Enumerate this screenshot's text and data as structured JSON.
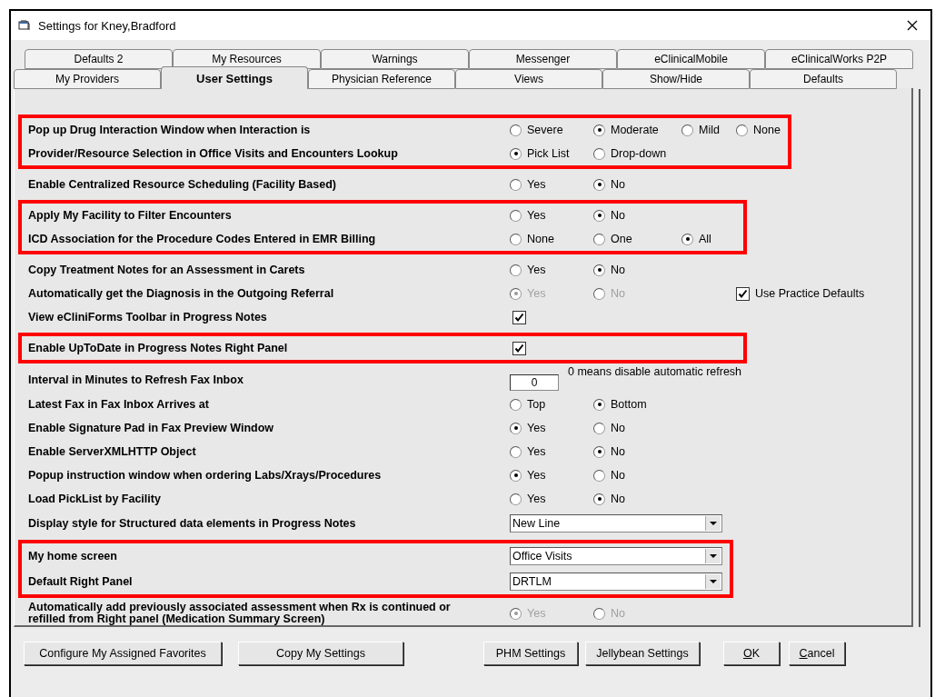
{
  "window": {
    "title": "Settings for Kney,Bradford"
  },
  "tabs": {
    "back_row": [
      {
        "label": "Defaults 2",
        "selected": false
      },
      {
        "label": "My Resources",
        "selected": false
      },
      {
        "label": "Warnings",
        "selected": false
      },
      {
        "label": "Messenger",
        "selected": false
      },
      {
        "label": "eClinicalMobile",
        "selected": false
      },
      {
        "label": "eClinicalWorks P2P",
        "selected": false
      }
    ],
    "front_row": [
      {
        "label": "My Providers",
        "selected": false
      },
      {
        "label": "User Settings",
        "selected": true
      },
      {
        "label": "Physician Reference",
        "selected": false
      },
      {
        "label": "Views",
        "selected": false
      },
      {
        "label": "Show/Hide",
        "selected": false
      },
      {
        "label": "Defaults",
        "selected": false
      }
    ]
  },
  "groups": [
    {
      "highlighted": true,
      "rows": [
        {
          "label": "Pop up Drug Interaction Window when Interaction is",
          "kind": "radio",
          "options": [
            {
              "label": "Severe",
              "selected": false,
              "disabled": false
            },
            {
              "label": "Moderate",
              "selected": true,
              "disabled": false
            },
            {
              "label": "Mild",
              "selected": false,
              "disabled": false
            },
            {
              "label": "None",
              "selected": false,
              "disabled": false
            }
          ]
        },
        {
          "label": "Provider/Resource Selection in Office Visits and Encounters Lookup",
          "kind": "radio",
          "options": [
            {
              "label": "Pick List",
              "selected": true,
              "disabled": false
            },
            {
              "label": "Drop-down",
              "selected": false,
              "disabled": false
            }
          ]
        }
      ]
    },
    {
      "highlighted": false,
      "rows": [
        {
          "label": "Enable Centralized Resource Scheduling (Facility Based)",
          "kind": "radio",
          "options": [
            {
              "label": "Yes",
              "selected": false,
              "disabled": false
            },
            {
              "label": "No",
              "selected": true,
              "disabled": false
            }
          ]
        }
      ]
    },
    {
      "highlighted": true,
      "rows": [
        {
          "label": "Apply My Facility to Filter Encounters",
          "kind": "radio",
          "options": [
            {
              "label": "Yes",
              "selected": false,
              "disabled": false
            },
            {
              "label": "No",
              "selected": true,
              "disabled": false
            }
          ]
        },
        {
          "label": "ICD Association for the Procedure Codes Entered in EMR Billing",
          "kind": "radio",
          "options": [
            {
              "label": "None",
              "selected": false,
              "disabled": false
            },
            {
              "label": "One",
              "selected": false,
              "disabled": false
            },
            {
              "label": "All",
              "selected": true,
              "disabled": false
            }
          ]
        }
      ]
    },
    {
      "highlighted": false,
      "rows": [
        {
          "label": "Copy Treatment Notes for an Assessment in Carets",
          "kind": "radio",
          "options": [
            {
              "label": "Yes",
              "selected": false,
              "disabled": false
            },
            {
              "label": "No",
              "selected": true,
              "disabled": false
            }
          ]
        },
        {
          "label": "Automatically get the Diagnosis in the Outgoing Referral",
          "kind": "radio",
          "options": [
            {
              "label": "Yes",
              "selected": true,
              "disabled": true
            },
            {
              "label": "No",
              "selected": false,
              "disabled": true
            }
          ],
          "extra_checkbox": {
            "label": "Use Practice Defaults",
            "checked": true
          }
        },
        {
          "label": "View eCliniForms Toolbar in Progress Notes",
          "kind": "checkbox",
          "checked": true
        }
      ]
    },
    {
      "highlighted": true,
      "rows": [
        {
          "label": "Enable UpToDate in Progress Notes Right Panel",
          "kind": "checkbox",
          "checked": true
        }
      ]
    },
    {
      "highlighted": false,
      "rows": [
        {
          "label": "Interval in Minutes to Refresh Fax Inbox",
          "kind": "number",
          "value": "0",
          "note": "0 means disable automatic refresh"
        },
        {
          "label": "Latest Fax in Fax Inbox Arrives at",
          "kind": "radio",
          "options": [
            {
              "label": "Top",
              "selected": false,
              "disabled": false
            },
            {
              "label": "Bottom",
              "selected": true,
              "disabled": false
            }
          ]
        },
        {
          "label": "Enable Signature Pad in Fax Preview Window",
          "kind": "radio",
          "options": [
            {
              "label": "Yes",
              "selected": true,
              "disabled": false
            },
            {
              "label": "No",
              "selected": false,
              "disabled": false
            }
          ]
        },
        {
          "label": "Enable ServerXMLHTTP Object",
          "kind": "radio",
          "options": [
            {
              "label": "Yes",
              "selected": false,
              "disabled": false
            },
            {
              "label": "No",
              "selected": true,
              "disabled": false
            }
          ]
        },
        {
          "label": "Popup instruction window when ordering Labs/Xrays/Procedures",
          "kind": "radio",
          "options": [
            {
              "label": "Yes",
              "selected": true,
              "disabled": false
            },
            {
              "label": "No",
              "selected": false,
              "disabled": false
            }
          ]
        },
        {
          "label": "Load PickList by Facility",
          "kind": "radio",
          "options": [
            {
              "label": "Yes",
              "selected": false,
              "disabled": false
            },
            {
              "label": "No",
              "selected": true,
              "disabled": false
            }
          ]
        },
        {
          "label": "Display style for Structured data elements in Progress Notes",
          "kind": "dropdown",
          "value": "New Line"
        }
      ]
    },
    {
      "highlighted": true,
      "rows": [
        {
          "label": "My home screen",
          "kind": "dropdown",
          "value": "Office Visits"
        },
        {
          "label": "Default Right Panel",
          "kind": "dropdown",
          "value": "DRTLM"
        }
      ]
    },
    {
      "highlighted": false,
      "rows": [
        {
          "label": "Automatically add previously associated assessment when Rx is continued or refilled from Right panel (Medication Summary Screen)",
          "kind": "radio",
          "options": [
            {
              "label": "Yes",
              "selected": true,
              "disabled": true
            },
            {
              "label": "No",
              "selected": false,
              "disabled": true
            }
          ]
        }
      ]
    }
  ],
  "buttons": [
    {
      "label": "Configure My Assigned Favorites",
      "accelerator": false
    },
    {
      "label": "Copy My Settings",
      "accelerator": false
    },
    {
      "label": "PHM Settings",
      "accelerator": false
    },
    {
      "label": "Jellybean Settings",
      "accelerator": false
    },
    {
      "label": "OK",
      "accelerator": true
    },
    {
      "label": "Cancel",
      "accelerator": true
    }
  ]
}
